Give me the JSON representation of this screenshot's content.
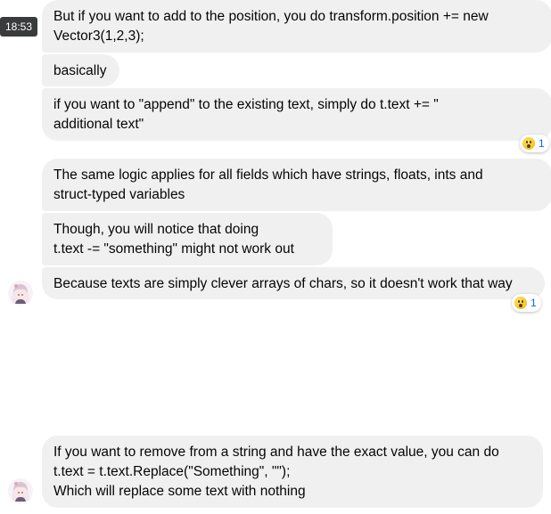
{
  "timestamp": "18:53",
  "messages": [
    {
      "text": "But if you want to add to the position, you do transform.position += new\nVector3(1,2,3);"
    },
    {
      "text": "basically"
    },
    {
      "text": "if you want to \"append\" to the existing text, simply do t.text += \"\nadditional text\""
    },
    {
      "text": "The same logic applies for all fields which have strings, floats, ints and\nstruct-typed variables"
    },
    {
      "text": "Though, you will notice that doing\nt.text -= \"something\" might not work out"
    },
    {
      "text": "Because texts are simply clever arrays of chars, so it doesn't work that way"
    },
    {
      "text": "If you want to remove from a string and have the exact value, you can do\nt.text = t.text.Replace(\"Something\", \"\");\nWhich will replace some text with nothing"
    }
  ],
  "reactions": [
    {
      "emoji": "surprised-face-icon",
      "count": "1"
    },
    {
      "emoji": "surprised-face-icon",
      "count": "1"
    }
  ],
  "colors": {
    "bubble": "#f0f0f0",
    "text": "#050505",
    "reaction_count": "#0866ff",
    "timestamp_bg": "#3a3b3c"
  }
}
